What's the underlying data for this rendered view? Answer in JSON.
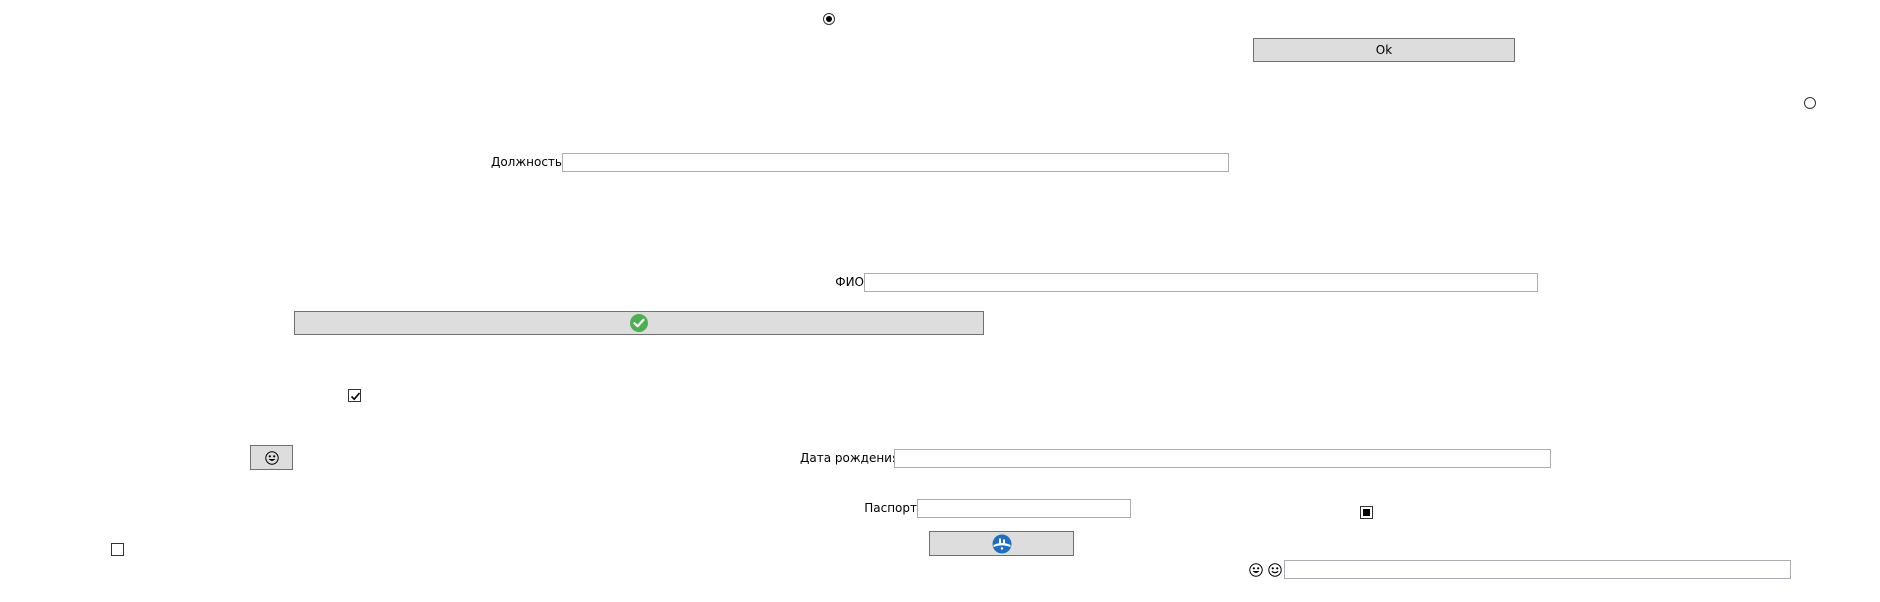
{
  "window": {
    "background_color": "#ffffff"
  },
  "controls": {
    "radio_top": {
      "checked": true
    },
    "radio_right": {
      "checked": false
    },
    "ok_button": {
      "label": "Ok"
    },
    "position_field": {
      "label": "Должность",
      "value": ""
    },
    "fio_field": {
      "label": "ФИО",
      "value": ""
    },
    "confirm_button": {
      "icon": "check-circle-icon",
      "icon_color": "#4caf50"
    },
    "checkbox_checked": {
      "checked": true
    },
    "emoji_button": {
      "icon": "smiley-face-icon"
    },
    "birth_date_field": {
      "label": "Дата рождения",
      "value": ""
    },
    "passport_field": {
      "label": "Паспорт",
      "value": ""
    },
    "checkbox_indeterminate": {
      "state": "indeterminate"
    },
    "checkbox_unchecked": {
      "checked": false
    },
    "globe_button": {
      "icon": "globe-icon",
      "icon_color": "#1e6fc4"
    },
    "bottom_field": {
      "icons": [
        "smiley-face-icon",
        "smiley-face-icon"
      ],
      "value": ""
    }
  }
}
